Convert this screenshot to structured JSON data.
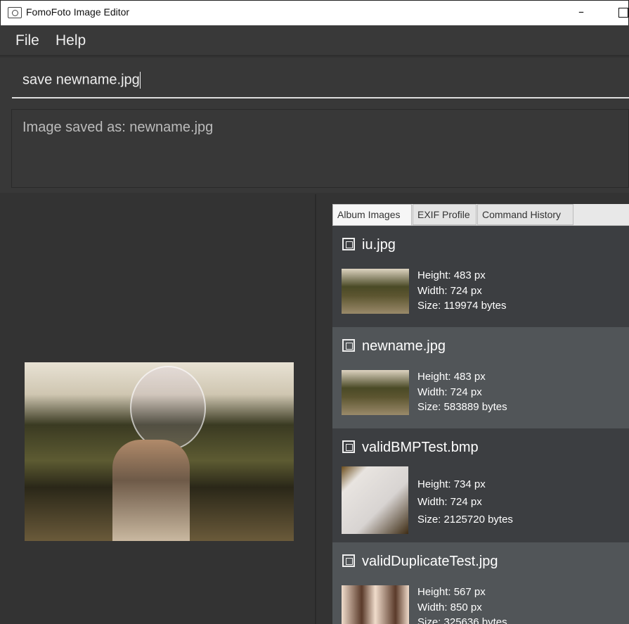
{
  "window": {
    "title": "FomoFoto Image Editor",
    "minimize": "–"
  },
  "menu": {
    "items": [
      "File",
      "Help"
    ]
  },
  "command": {
    "value": "save newname.jpg"
  },
  "result": {
    "text": "Image saved as: newname.jpg"
  },
  "tabs": [
    {
      "label": "Album Images",
      "active": true
    },
    {
      "label": "EXIF Profile",
      "active": false
    },
    {
      "label": "Command History",
      "active": false
    }
  ],
  "album": [
    {
      "name": "iu.jpg",
      "height": "Height: 483 px",
      "width": "Width: 724 px",
      "size": "Size: 119974 bytes"
    },
    {
      "name": "newname.jpg",
      "height": "Height: 483 px",
      "width": "Width: 724 px",
      "size": "Size: 583889 bytes"
    },
    {
      "name": "validBMPTest.bmp",
      "height": "Height: 734 px",
      "width": "Width: 724 px",
      "size": "Size: 2125720 bytes"
    },
    {
      "name": "validDuplicateTest.jpg",
      "height": "Height: 567 px",
      "width": "Width: 850 px",
      "size": "Size: 325636 bytes"
    }
  ]
}
